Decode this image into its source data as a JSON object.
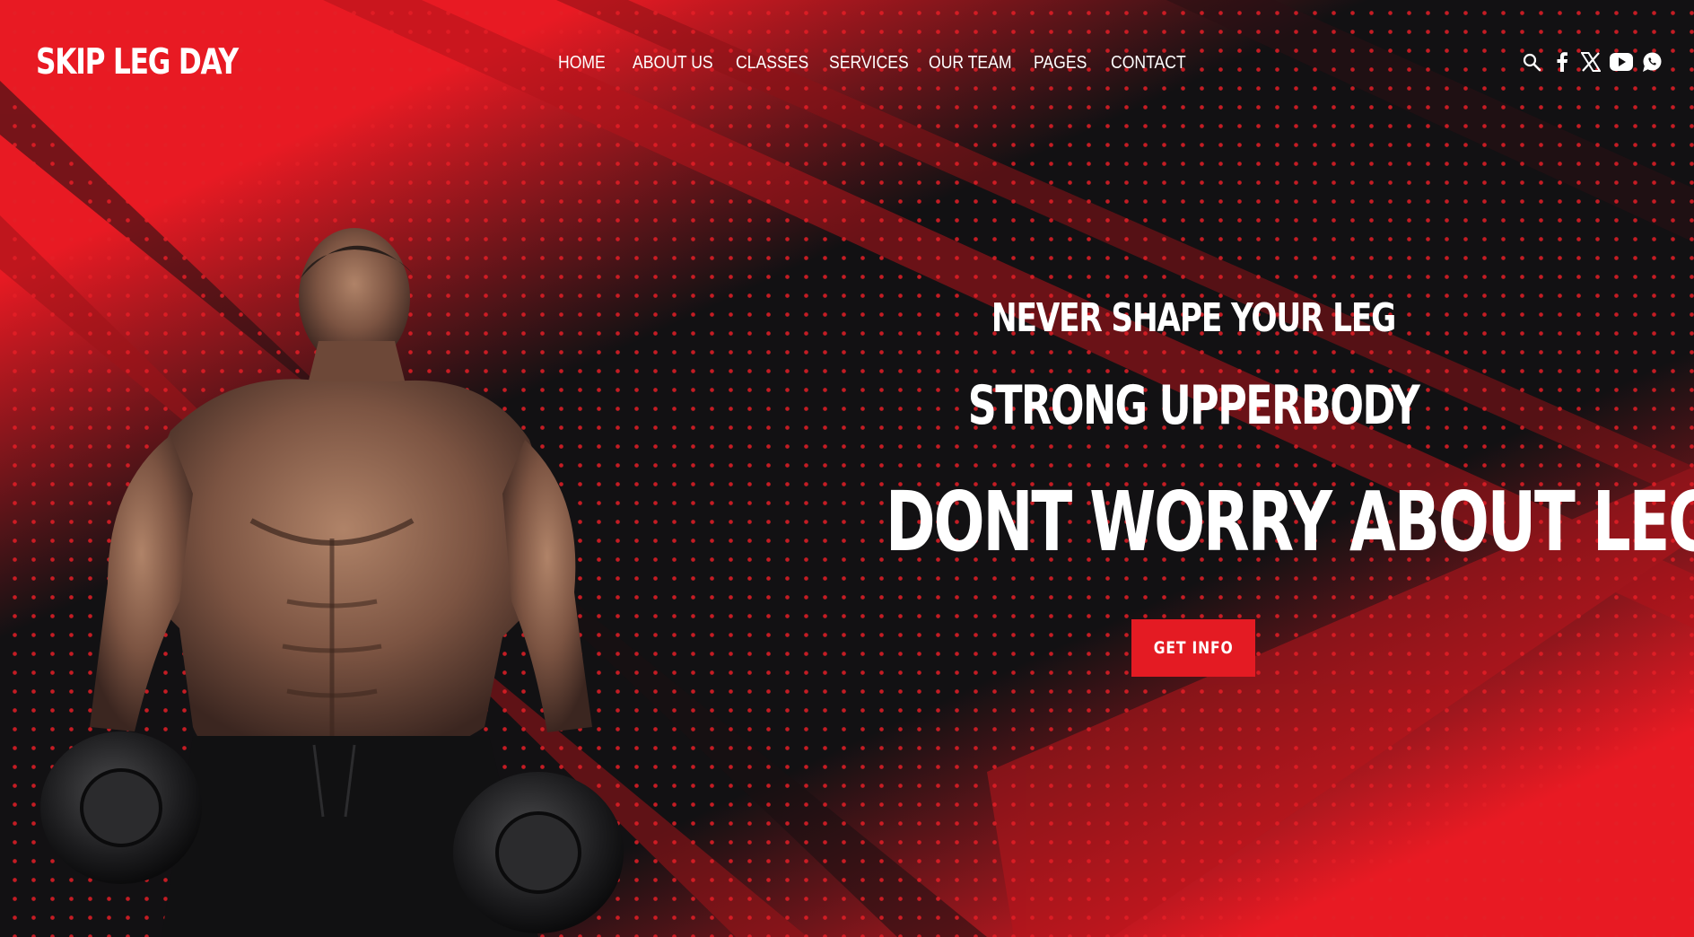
{
  "brand": {
    "logo": "SKIP LEG DAY"
  },
  "nav": {
    "items": [
      {
        "label": "HOME"
      },
      {
        "label": "ABOUT US"
      },
      {
        "label": "CLASSES"
      },
      {
        "label": "SERVICES"
      },
      {
        "label": "OUR TEAM"
      },
      {
        "label": "PAGES"
      },
      {
        "label": "CONTACT"
      }
    ]
  },
  "header_icons": [
    "search-icon",
    "facebook-icon",
    "x-twitter-icon",
    "youtube-icon",
    "whatsapp-icon"
  ],
  "hero": {
    "line_1": "NEVER SHAPE YOUR LEG",
    "line_2": "STRONG UPPERBODY",
    "line_3": "DONT WORRY ABOUT LEG DAY",
    "cta_label": "GET INFO"
  },
  "colors": {
    "accent": "#e41b23",
    "background": "#121113",
    "text": "#ffffff"
  }
}
